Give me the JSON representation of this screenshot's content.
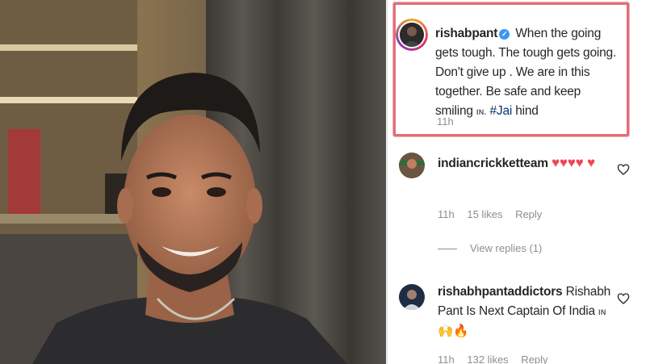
{
  "post": {
    "username": "rishabpant",
    "verified_glyph": "✓",
    "caption_main": "When the going gets tough. The tough gets going. Don't give up . We are in this together. Be safe and keep smiling",
    "caption_flag": "IN.",
    "caption_hashtag": "#Jai",
    "caption_end": "hind",
    "timestamp": "11h"
  },
  "comments": [
    {
      "username": "indiancrickketteam",
      "text": "♥♥♥♥ ♥",
      "time": "11h",
      "likes": "15 likes",
      "reply": "Reply",
      "view_replies": "View replies (1)"
    },
    {
      "username": "rishabhpantaddictors",
      "text": "Rishabh Pant Is Next Captain Of India",
      "flag": "IN",
      "emoji": "🙌🔥",
      "time": "11h",
      "likes": "132 likes",
      "reply": "Reply"
    }
  ],
  "colors": {
    "highlight_border": "#e26d79",
    "verified_blue": "#3897f0",
    "hashtag": "#00376b",
    "heart": "#ed4956"
  },
  "icons": {
    "like": "heart-outline-icon",
    "verified": "verified-badge-icon"
  }
}
